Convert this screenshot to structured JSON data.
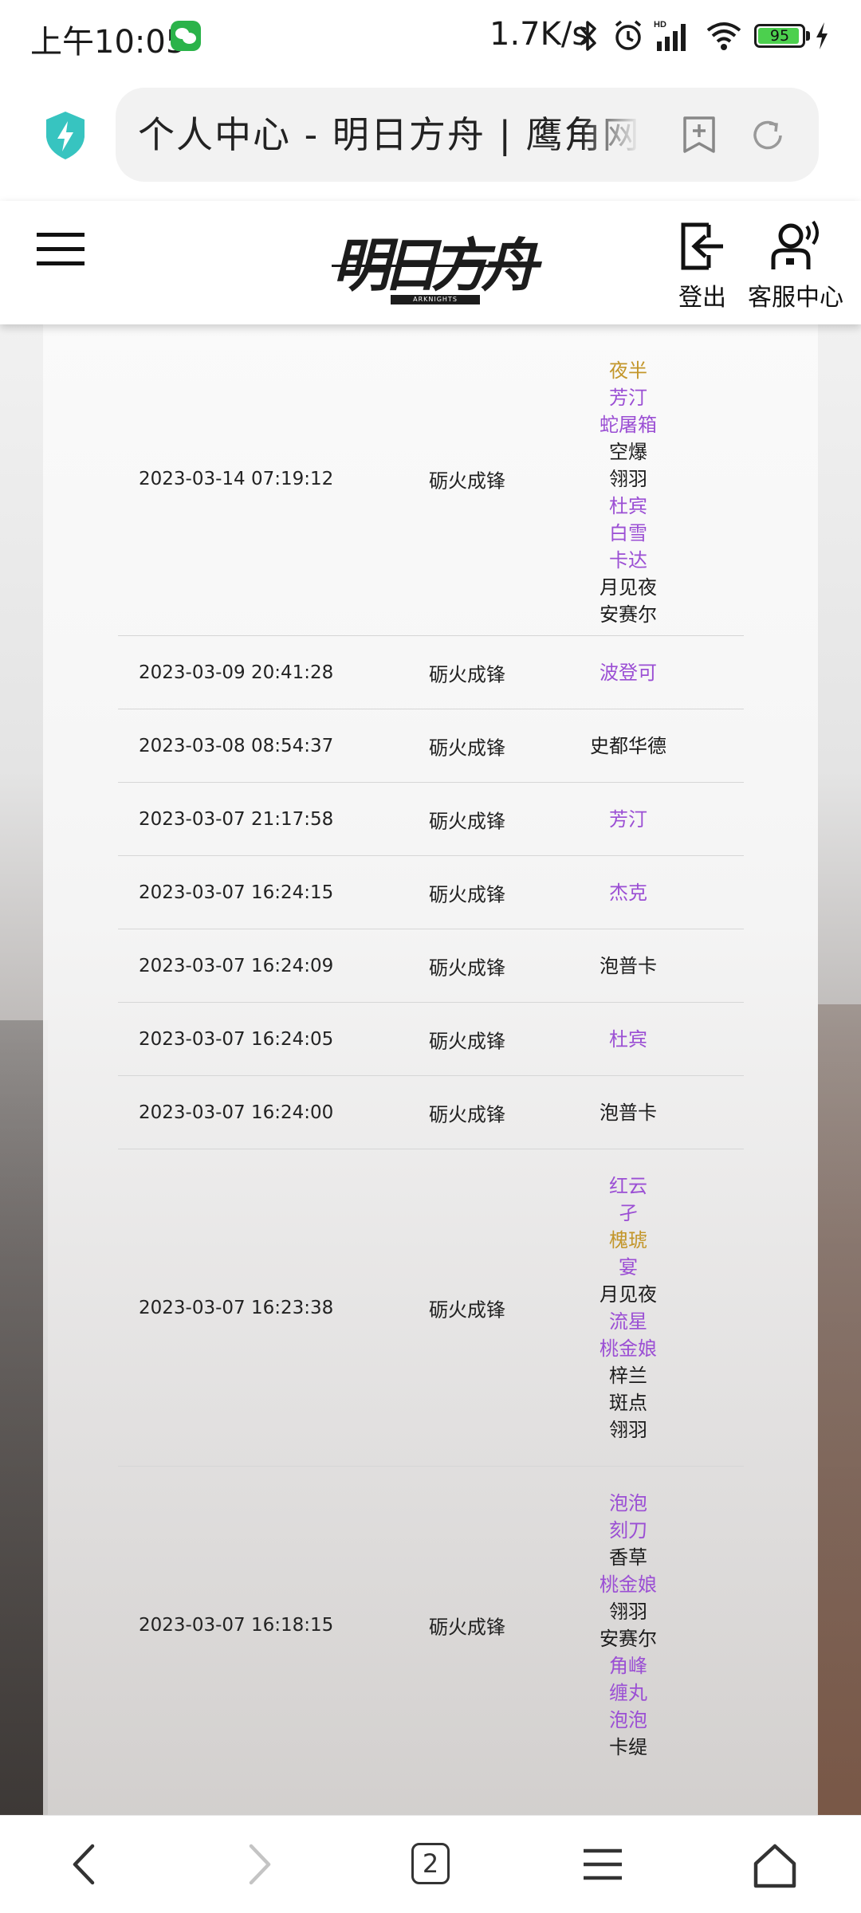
{
  "status_bar": {
    "time": "上午10:05",
    "net_speed": "1.7K/s",
    "battery": "95",
    "battery_level": 0.95,
    "app_icon": "wechat-icon",
    "icons": [
      "bluetooth-icon",
      "alarm-icon",
      "hd-signal-icon",
      "wifi-icon",
      "battery-icon",
      "charging-icon"
    ]
  },
  "browser": {
    "url_title": "个人中心 - 明日方舟 | 鹰角网络",
    "icons": [
      "shield-icon",
      "bookmark-add-icon",
      "reload-icon"
    ]
  },
  "header": {
    "logo_text": "明日方舟",
    "logo_sub": "ARKNIGHTS",
    "logout_label": "登出",
    "service_label": "客服中心",
    "icons": [
      "menu-icon",
      "logout-icon",
      "customer-service-icon"
    ]
  },
  "colors": {
    "gold": "#c3962a",
    "purple": "#9b4fd4",
    "normal": "#1c1c1c"
  },
  "records": [
    {
      "time": "2023-03-14 07:19:12",
      "pool": "砺火成锋",
      "operators": [
        {
          "name": "夜半",
          "rarity": "gold"
        },
        {
          "name": "芳汀",
          "rarity": "purple"
        },
        {
          "name": "蛇屠箱",
          "rarity": "purple"
        },
        {
          "name": "空爆",
          "rarity": "normal"
        },
        {
          "name": "翎羽",
          "rarity": "normal"
        },
        {
          "name": "杜宾",
          "rarity": "purple"
        },
        {
          "name": "白雪",
          "rarity": "purple"
        },
        {
          "name": "卡达",
          "rarity": "purple"
        },
        {
          "name": "月见夜",
          "rarity": "normal"
        },
        {
          "name": "安赛尔",
          "rarity": "normal"
        }
      ]
    },
    {
      "time": "2023-03-09 20:41:28",
      "pool": "砺火成锋",
      "operators": [
        {
          "name": "波登可",
          "rarity": "purple"
        }
      ]
    },
    {
      "time": "2023-03-08 08:54:37",
      "pool": "砺火成锋",
      "operators": [
        {
          "name": "史都华德",
          "rarity": "normal"
        }
      ]
    },
    {
      "time": "2023-03-07 21:17:58",
      "pool": "砺火成锋",
      "operators": [
        {
          "name": "芳汀",
          "rarity": "purple"
        }
      ]
    },
    {
      "time": "2023-03-07 16:24:15",
      "pool": "砺火成锋",
      "operators": [
        {
          "name": "杰克",
          "rarity": "purple"
        }
      ]
    },
    {
      "time": "2023-03-07 16:24:09",
      "pool": "砺火成锋",
      "operators": [
        {
          "name": "泡普卡",
          "rarity": "normal"
        }
      ]
    },
    {
      "time": "2023-03-07 16:24:05",
      "pool": "砺火成锋",
      "operators": [
        {
          "name": "杜宾",
          "rarity": "purple"
        }
      ]
    },
    {
      "time": "2023-03-07 16:24:00",
      "pool": "砺火成锋",
      "operators": [
        {
          "name": "泡普卡",
          "rarity": "normal"
        }
      ]
    },
    {
      "time": "2023-03-07 16:23:38",
      "pool": "砺火成锋",
      "operators": [
        {
          "name": "红云",
          "rarity": "purple"
        },
        {
          "name": "孑",
          "rarity": "purple"
        },
        {
          "name": "槐琥",
          "rarity": "gold"
        },
        {
          "name": "宴",
          "rarity": "purple"
        },
        {
          "name": "月见夜",
          "rarity": "normal"
        },
        {
          "name": "流星",
          "rarity": "purple"
        },
        {
          "name": "桃金娘",
          "rarity": "purple"
        },
        {
          "name": "梓兰",
          "rarity": "normal"
        },
        {
          "name": "斑点",
          "rarity": "normal"
        },
        {
          "name": "翎羽",
          "rarity": "normal"
        }
      ]
    },
    {
      "time": "2023-03-07 16:18:15",
      "pool": "砺火成锋",
      "operators": [
        {
          "name": "泡泡",
          "rarity": "purple"
        },
        {
          "name": "刻刀",
          "rarity": "purple"
        },
        {
          "name": "香草",
          "rarity": "normal"
        },
        {
          "name": "桃金娘",
          "rarity": "purple"
        },
        {
          "name": "翎羽",
          "rarity": "normal"
        },
        {
          "name": "安赛尔",
          "rarity": "normal"
        },
        {
          "name": "角峰",
          "rarity": "purple"
        },
        {
          "name": "缠丸",
          "rarity": "purple"
        },
        {
          "name": "泡泡",
          "rarity": "purple"
        },
        {
          "name": "卡缇",
          "rarity": "normal"
        }
      ]
    }
  ],
  "bottom_nav": {
    "tab_count": "2",
    "icons": [
      "back-icon",
      "forward-icon",
      "tabs-icon",
      "menu-icon",
      "home-icon"
    ]
  }
}
